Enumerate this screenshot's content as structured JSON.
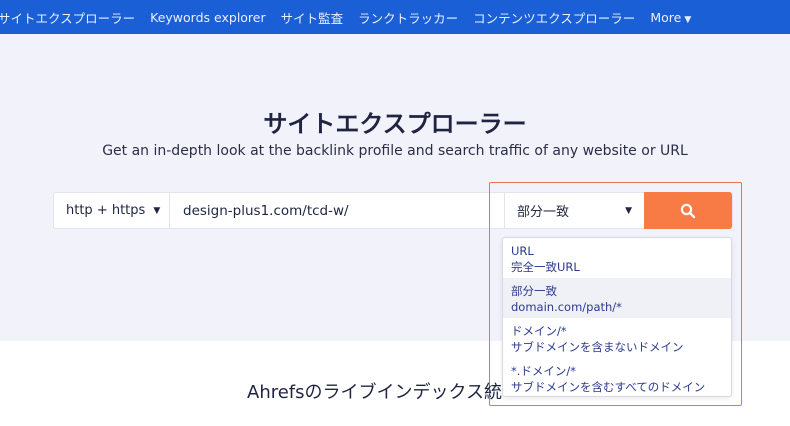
{
  "nav": {
    "items": [
      "サイトエクスプローラー",
      "Keywords explorer",
      "サイト監査",
      "ランクトラッカー",
      "コンテンツエクスプローラー"
    ],
    "more_label": "More"
  },
  "hero": {
    "title": "サイトエクスプローラー",
    "subtitle": "Get an in-depth look at the backlink profile and search traffic of any website or URL"
  },
  "search": {
    "protocol": "http + https",
    "url_value": "design-plus1.com/tcd-w/",
    "mode": "部分一致"
  },
  "dropdown": {
    "options": [
      {
        "title": "URL",
        "desc": "完全一致URL"
      },
      {
        "title": "部分一致",
        "desc": "domain.com/path/*"
      },
      {
        "title": "ドメイン/*",
        "desc": "サブドメインを含まないドメイン"
      },
      {
        "title": "*.ドメイン/*",
        "desc": "サブドメインを含むすべてのドメイン"
      }
    ]
  },
  "bottom": {
    "heading": "Ahrefsのライブインデックス統"
  },
  "colors": {
    "nav_bg": "#1a5fd6",
    "accent": "#f87b46",
    "highlight": "#e8735a"
  }
}
